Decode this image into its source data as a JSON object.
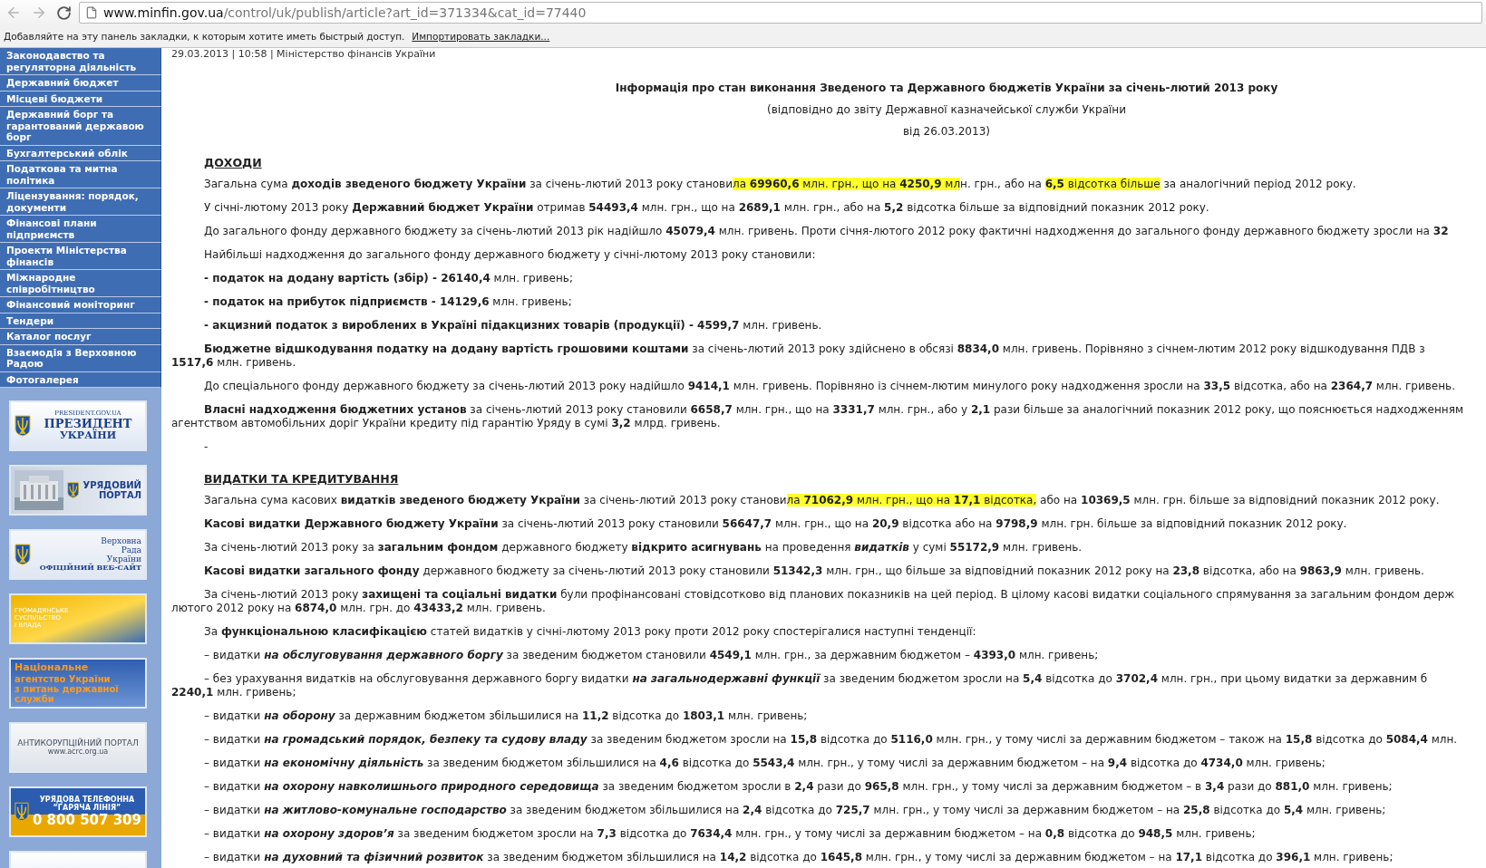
{
  "browser": {
    "url_host": "www.minfin.gov.ua",
    "url_path": "/control/uk/publish/article?art_id=371334&cat_id=77440",
    "bookmarks_hint": "Добавляйте на эту панель закладки, к которым хотите иметь быстрый доступ.",
    "bookmarks_link": "Импортировать закладки..."
  },
  "sidebar": {
    "menu": [
      "Законодавство та регуляторна діяльність",
      "Державний бюджет",
      "Місцеві бюджети",
      "Державний борг та гарантований державою борг",
      "Бухгалтерський облік",
      "Податкова та митна політика",
      "Ліцензування: порядок, документи",
      "Фінансові плани підприємств",
      "Проекти Міністерства фінансів",
      "Міжнародне співробітництво",
      "Фінансовий моніторинг",
      "Тендери",
      "Каталог послуг",
      "Взаємодія з Верховною Радою",
      "Фотогалерея"
    ],
    "banners": [
      {
        "kind": "president",
        "lines": [
          "PRESIDENT.GOV.UA",
          "ПРЕЗИДЕНТ",
          "УКРАЇНИ"
        ]
      },
      {
        "kind": "government",
        "lines": [
          "УРЯДОВИЙ",
          "ПОРТАЛ"
        ]
      },
      {
        "kind": "rada",
        "lines": [
          "Верховна",
          "Рада",
          "України",
          "ОФІЦІЙНИЙ ВЕБ-САЙТ"
        ]
      },
      {
        "kind": "society",
        "lines": [
          "ГРОМАДЯНСЬКЕ",
          "СУСПІЛЬСТВО",
          "І ВЛАДА"
        ]
      },
      {
        "kind": "agency",
        "lines": [
          "Національне",
          "агентство України",
          "з питань державної",
          "служби"
        ]
      },
      {
        "kind": "anticorruption",
        "lines": [
          "АНТИКОРУПЦІЙНИЙ ПОРТАЛ",
          "www.acrc.org.ua"
        ]
      },
      {
        "kind": "hotline",
        "lines": [
          "УРЯДОВА ТЕЛЕФОННА",
          "“ГАРЯЧА ЛІНІЯ”",
          "0 800 507 309"
        ]
      },
      {
        "kind": "partial"
      }
    ]
  },
  "article": {
    "meta": "29.03.2013 | 10:58 | Міністерство фінансів України",
    "title": "Інформація про стан виконання Зведеного та Державного бюджетів України за січень-лютий 2013 року",
    "subtitle_lines": [
      "(відповідно до звіту Державної казначейської служби України",
      "від 26.03.2013)"
    ],
    "sections": [
      {
        "heading": "ДОХОДИ",
        "paragraphs": [
          {
            "parts": [
              {
                "text": "Загальна сума **доходів зведеного бюджету України** за січень-лютий 2013 року станови",
                "highlight": false
              },
              {
                "text": "ла **69960,6** млн. грн., що на **4250,9** мл",
                "highlight": true
              },
              {
                "text": "н. грн., або на ",
                "highlight": false
              },
              {
                "text": "**6,5** відсотка більше",
                "highlight": true
              },
              {
                "text": " за аналогічний період 2012 року.",
                "highlight": false
              }
            ]
          },
          {
            "text": "У січні-лютому 2013 року **Державний бюджет України** отримав **54493,4** млн. грн., що на **2689,1** млн. грн., або на **5,2** відсотка більше за відповідний показник 2012 року."
          },
          {
            "text": "До загального фонду державного бюджету за січень-лютий 2013 рік надійшло **45079,4** млн. гривень. Проти січня-лютого 2012 року фактичні надходження до загального фонду державного бюджету зросли на **32**"
          },
          {
            "text": "Найбільші надходження до загального фонду державного бюджету у січні-лютому 2013 року становили:"
          },
          {
            "text": "**- податок на додану вартість (збір) - 26140,4** млн. гривень;"
          },
          {
            "text": "**- податок на прибуток підприємств - 14129,6** млн. гривень;"
          },
          {
            "text": "**- акцизний податок з вироблених в Україні підакцизних товарів (продукції) - 4599,7** млн. гривень."
          },
          {
            "text": "**Бюджетне відшкодування податку на додану вартість грошовими коштами** за січень-лютий 2013 року здійснено в обсязі **8834,0** млн. гривень. Порівняно з січнем-лютим 2012 року відшкодування ПДВ з",
            "continuation": "**1517,6** млн. гривень."
          },
          {
            "text": "До спеціального фонду державного бюджету за січень-лютий 2013 року надійшло **9414,1** млн. гривень. Порівняно із січнем-лютим минулого року надходження зросли на **33,5** відсотка, або на **2364,7** млн. гривень."
          },
          {
            "text": "**Власні надходження бюджетних установ** за січень-лютий 2013 року становили **6658,7** млн. грн., що на **3331,7** млн. грн., або у **2,1** рази більше за аналогічний показник 2012 року, що пояснюється надходженням",
            "continuation": "агентством автомобільних доріг України кредиту під гарантію Уряду в сумі **3,2** млрд. гривень."
          },
          {
            "text": "-"
          }
        ]
      },
      {
        "heading": "ВИДАТКИ ТА КРЕДИТУВАННЯ",
        "paragraphs": [
          {
            "parts": [
              {
                "text": "Загальна сума касових **видатків зведеного бюджету України** за січень-лютий 2013 року станови",
                "highlight": false
              },
              {
                "text": "ла **71062,9** млн. грн., що на **17,1** відсотка,",
                "highlight": true
              },
              {
                "text": " або на **10369,5** млн. грн. більше за відповідний показник 2012 року.",
                "highlight": false
              }
            ]
          },
          {
            "text": "**Касові видатки Державного бюджету України** за січень-лютий 2013 року становили **56647,7** млн. грн., що на **20,9** відсотка або на **9798,9** млн. грн. більше за відповідний показник 2012 року."
          },
          {
            "text": "За січень-лютий 2013 року за **загальним фондом** державного бюджету **відкрито асигнувань** на проведення *видатків* у сумі **55172,9** млн. гривень."
          },
          {
            "text": "**Касові видатки загального фонду** державного бюджету за січень-лютий 2013 року становили **51342,3** млн. грн., що більше за відповідний показник 2012 року на **23,8** відсотка, або на **9863,9** млн. гривень."
          },
          {
            "text": "За січень-лютий 2013 року **захищені та соціальні видатки** були профінансовані стовідсотково від планових показників на цей період. В цілому касові видатки  соціального спрямування за загальним фондом держ",
            "continuation": "лютого 2012 року на **6874,0** млн. грн. до **43433,2** млн. гривень."
          },
          {
            "text": "За **функціональною класифікацією** статей видатків у січні-лютому 2013 року проти 2012 року спостерігалися наступні тенденції:"
          },
          {
            "text": "–  видатки *на обслуговування державного боргу* за зведеним бюджетом становили **4549,1** млн. грн., за державним бюджетом – **4393,0** млн. гривень;"
          },
          {
            "text": "– без урахування видатків на обслуговування державного боргу видатки *на загальнодержавні функції* за зведеним бюджетом зросли на **5,4** відсотка до **3702,4** млн. грн., при цьому видатки за державним б",
            "continuation": "**2240,1** млн. гривень;"
          },
          {
            "text": "– видатки *на оборону* за державним бюджетом збільшилися на **11,2** відсотка до **1803,1** млн. гривень;"
          },
          {
            "text": "– видатки *на громадський порядок, безпеку та судову владу* за зведеним бюджетом зросли на **15,8** відсотка до **5116,0** млн. грн., у тому числі за державним бюджетом – також на **15,8** відсотка до **5084,4** млн."
          },
          {
            "text": "– видатки *на економічну діяльність* за зведеним бюджетом збільшилися на **4,6** відсотка до **5543,4** млн. грн., у тому числі за державним бюджетом – на **9,4** відсотка до **4734,0** млн. гривень;"
          },
          {
            "text": "– видатки *на охорону навколишнього природного середовища* за зведеним бюджетом зросли в **2,4** рази до **965,8** млн. грн., у тому числі за державним бюджетом – в **3,4** рази до **881,0** млн. гривень;"
          },
          {
            "text": "– видатки *на житлово-комунальне господарство* за зведеним бюджетом збільшилися на **2,4** відсотка до **725,7** млн. грн., у тому числі за державним бюджетом – на **25,8** відсотка до **5,4** млн. гривень;"
          },
          {
            "text": "– видатки *на охорону здоров’я* за зведеним бюджетом зросли на **7,3** відсотка до **7634,4** млн. грн., у тому числі за державним бюджетом – на **0,8** відсотка до **948,5** млн. гривень;"
          },
          {
            "text": "– видатки *на духовний та фізичний розвиток* за зведеним бюджетом збільшилися на **14,2** відсотка до **1645,8** млн. грн., у тому числі за державним бюджетом – на **17,1** відсотка до **396,1** млн. гривень;"
          }
        ]
      }
    ]
  }
}
